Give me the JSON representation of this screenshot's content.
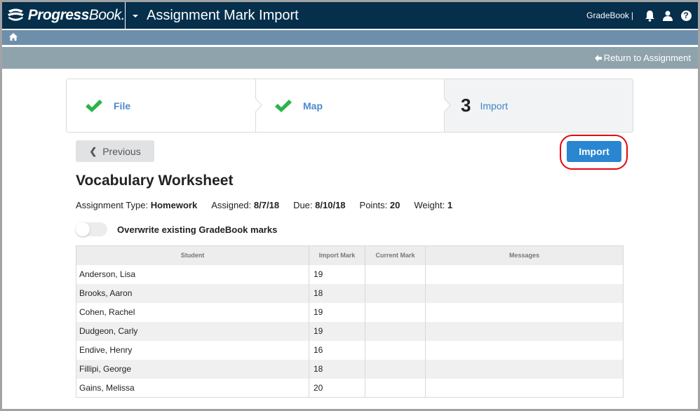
{
  "app": {
    "brand": "Progress",
    "brand_suffix": "Book",
    "brand_dot": ".",
    "page_title": "Assignment Mark Import",
    "product_link": "GradeBook",
    "product_sep": "|"
  },
  "colors": {
    "topbar": "#052f4b",
    "breadcrumb_bar": "#6e8fab",
    "sub_bar": "#8fa3ad",
    "accent_blue": "#2a86d0",
    "check_green": "#2db34a",
    "highlight_red": "#e5050f"
  },
  "header_icons": [
    "bell-icon",
    "user-icon",
    "help-icon"
  ],
  "help_glyph": "?",
  "subbar": {
    "return_label": "Return to Assignment"
  },
  "stepper": {
    "steps": [
      {
        "label": "File",
        "status": "complete"
      },
      {
        "label": "Map",
        "status": "complete"
      },
      {
        "number": "3",
        "label": "Import",
        "status": "current"
      }
    ]
  },
  "actions": {
    "previous_label": "Previous",
    "previous_glyph": "❮",
    "import_label": "Import"
  },
  "assignment": {
    "title": "Vocabulary Worksheet",
    "type_label": "Assignment Type:",
    "type_value": "Homework",
    "assigned_label": "Assigned:",
    "assigned_value": "8/7/18",
    "due_label": "Due:",
    "due_value": "8/10/18",
    "points_label": "Points:",
    "points_value": "20",
    "weight_label": "Weight:",
    "weight_value": "1"
  },
  "overwrite": {
    "label": "Overwrite existing GradeBook marks",
    "enabled": false
  },
  "table": {
    "headers": [
      "Student",
      "Import Mark",
      "Current Mark",
      "Messages"
    ],
    "rows": [
      {
        "student": "Anderson, Lisa",
        "import_mark": "19",
        "current_mark": "",
        "message": ""
      },
      {
        "student": "Brooks, Aaron",
        "import_mark": "18",
        "current_mark": "",
        "message": ""
      },
      {
        "student": "Cohen, Rachel",
        "import_mark": "19",
        "current_mark": "",
        "message": ""
      },
      {
        "student": "Dudgeon, Carly",
        "import_mark": "19",
        "current_mark": "",
        "message": ""
      },
      {
        "student": "Endive, Henry",
        "import_mark": "16",
        "current_mark": "",
        "message": ""
      },
      {
        "student": "Fillipi, George",
        "import_mark": "18",
        "current_mark": "",
        "message": ""
      },
      {
        "student": "Gains, Melissa",
        "import_mark": "20",
        "current_mark": "",
        "message": ""
      }
    ]
  }
}
